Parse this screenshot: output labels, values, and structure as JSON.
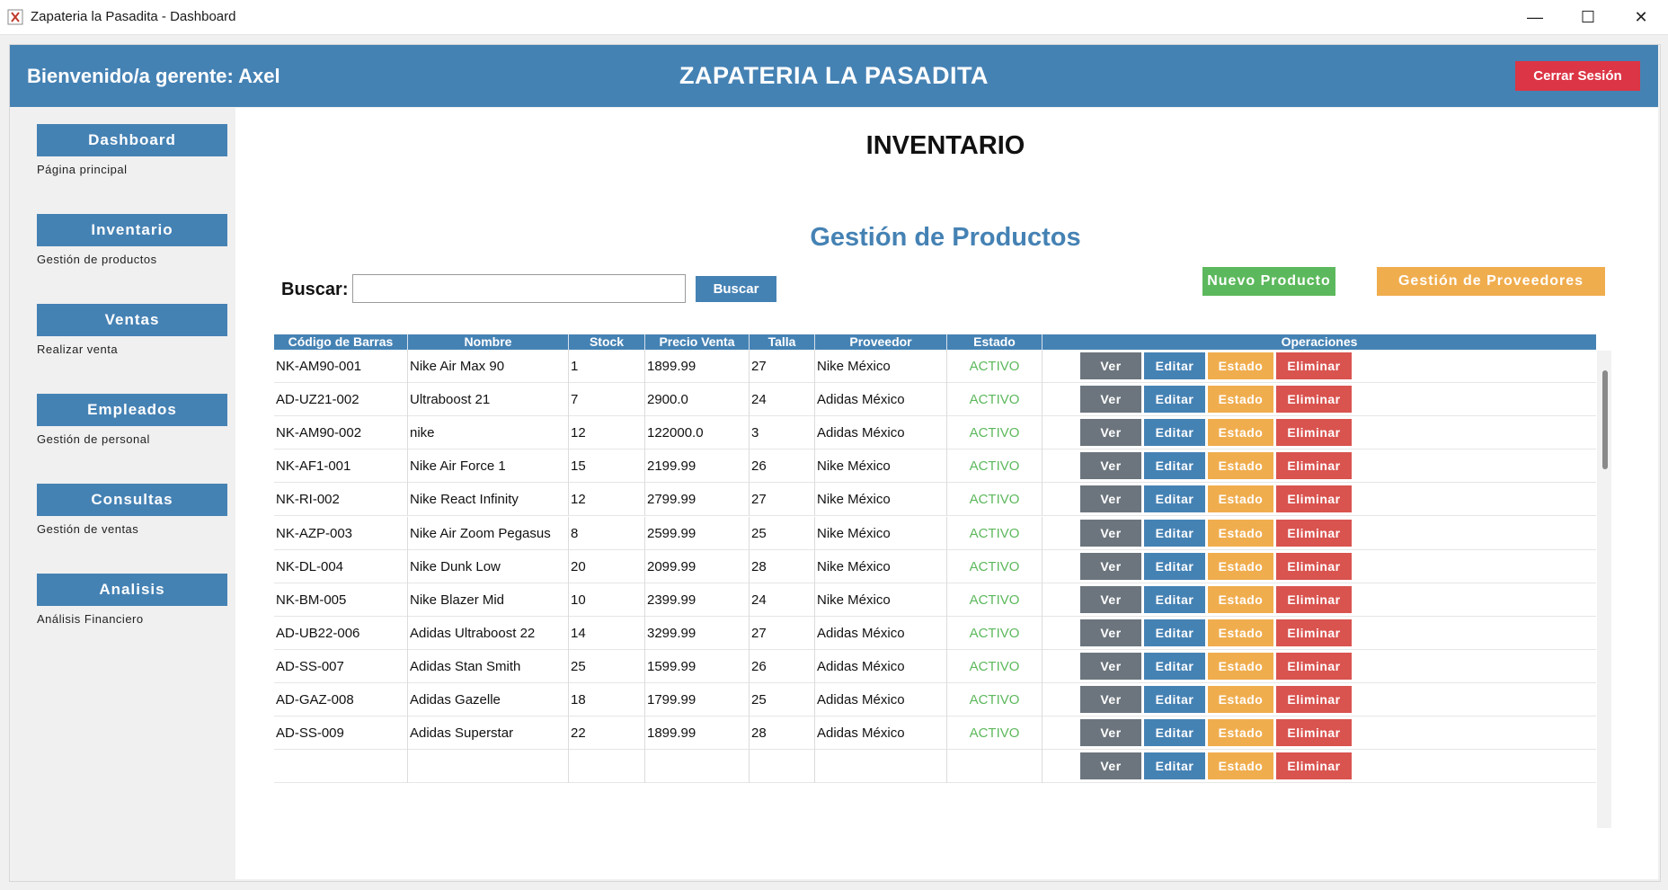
{
  "window": {
    "title": "Zapateria la Pasadita - Dashboard",
    "controls": {
      "minimize": "—",
      "maximize": "☐",
      "close": "✕"
    }
  },
  "header": {
    "welcome": "Bienvenido/a gerente: Axel",
    "brand": "ZAPATERIA LA PASADITA",
    "logout_label": "Cerrar Sesión"
  },
  "sidebar": {
    "items": [
      {
        "label": "Dashboard",
        "desc": "Página principal"
      },
      {
        "label": "Inventario",
        "desc": "Gestión de productos"
      },
      {
        "label": "Ventas",
        "desc": "Realizar venta"
      },
      {
        "label": "Empleados",
        "desc": "Gestión de personal"
      },
      {
        "label": "Consultas",
        "desc": "Gestión de ventas"
      },
      {
        "label": "Analisis",
        "desc": "Análisis Financiero"
      }
    ]
  },
  "main": {
    "page_title": "INVENTARIO",
    "section_title": "Gestión de Productos",
    "search": {
      "label": "Buscar:",
      "value": "",
      "placeholder": "",
      "button": "Buscar"
    },
    "new_product_label": "Nuevo Producto",
    "providers_label": "Gestión de Proveedores"
  },
  "table": {
    "columns": [
      "Código de Barras",
      "Nombre",
      "Stock",
      "Precio Venta",
      "Talla",
      "Proveedor",
      "Estado",
      "Operaciones"
    ],
    "actions": {
      "view": "Ver",
      "edit": "Editar",
      "status": "Estado",
      "delete": "Eliminar"
    },
    "rows": [
      {
        "code": "NK-AM90-001",
        "name": "Nike Air Max 90",
        "stock": "1",
        "price": "1899.99",
        "size": "27",
        "provider": "Nike México",
        "status": "ACTIVO"
      },
      {
        "code": "AD-UZ21-002",
        "name": "Ultraboost 21",
        "stock": "7",
        "price": "2900.0",
        "size": "24",
        "provider": "Adidas México",
        "status": "ACTIVO"
      },
      {
        "code": "NK-AM90-002",
        "name": "nike",
        "stock": "12",
        "price": "122000.0",
        "size": "3",
        "provider": "Adidas México",
        "status": "ACTIVO"
      },
      {
        "code": "NK-AF1-001",
        "name": "Nike Air Force 1",
        "stock": "15",
        "price": "2199.99",
        "size": "26",
        "provider": "Nike México",
        "status": "ACTIVO"
      },
      {
        "code": "NK-RI-002",
        "name": "Nike React Infinity",
        "stock": "12",
        "price": "2799.99",
        "size": "27",
        "provider": "Nike México",
        "status": "ACTIVO"
      },
      {
        "code": "NK-AZP-003",
        "name": "Nike Air Zoom Pegasus",
        "stock": "8",
        "price": "2599.99",
        "size": "25",
        "provider": "Nike México",
        "status": "ACTIVO"
      },
      {
        "code": "NK-DL-004",
        "name": "Nike Dunk Low",
        "stock": "20",
        "price": "2099.99",
        "size": "28",
        "provider": "Nike México",
        "status": "ACTIVO"
      },
      {
        "code": "NK-BM-005",
        "name": "Nike Blazer Mid",
        "stock": "10",
        "price": "2399.99",
        "size": "24",
        "provider": "Nike México",
        "status": "ACTIVO"
      },
      {
        "code": "AD-UB22-006",
        "name": "Adidas Ultraboost 22",
        "stock": "14",
        "price": "3299.99",
        "size": "27",
        "provider": "Adidas México",
        "status": "ACTIVO"
      },
      {
        "code": "AD-SS-007",
        "name": "Adidas Stan Smith",
        "stock": "25",
        "price": "1599.99",
        "size": "26",
        "provider": "Adidas México",
        "status": "ACTIVO"
      },
      {
        "code": "AD-GAZ-008",
        "name": "Adidas Gazelle",
        "stock": "18",
        "price": "1799.99",
        "size": "25",
        "provider": "Adidas México",
        "status": "ACTIVO"
      },
      {
        "code": "AD-SS-009",
        "name": "Adidas Superstar",
        "stock": "22",
        "price": "1899.99",
        "size": "28",
        "provider": "Adidas México",
        "status": "ACTIVO"
      },
      {
        "code": "",
        "name": "",
        "stock": "",
        "price": "",
        "size": "",
        "provider": "",
        "status": ""
      }
    ]
  },
  "colors": {
    "primary": "#4582b4",
    "danger": "#dc3545",
    "success": "#5cb85c",
    "warning": "#f0ad4e",
    "secondary": "#6c757d",
    "delete": "#d9534f"
  }
}
